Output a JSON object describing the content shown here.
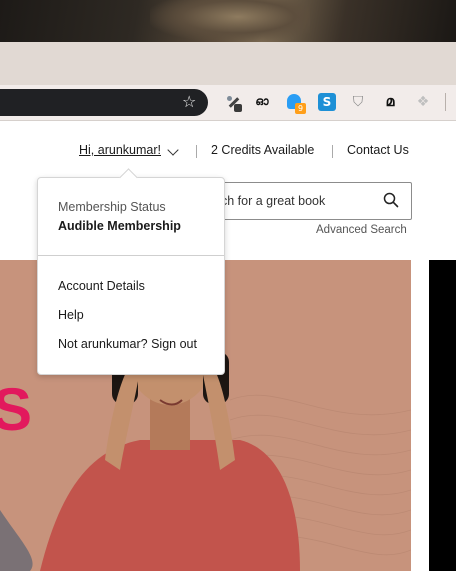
{
  "browser": {
    "extensions": [
      "eyedropper-icon",
      "glasses-icon",
      "ghost-icon",
      "s-extension-icon",
      "pocket-icon",
      "malayalam-icon",
      "grid-icon"
    ],
    "ghost_badge": "9",
    "glasses_glyph": "ഓ",
    "s_glyph": "S",
    "ml_glyph": "മ"
  },
  "header": {
    "greeting": "Hi, arunkumar!",
    "credits": "2 Credits Available",
    "contact": "Contact Us"
  },
  "search": {
    "placeholder": "ch for a great book",
    "advanced": "Advanced Search"
  },
  "account_menu": {
    "status_label": "Membership Status",
    "status_value": "Audible Membership",
    "items": [
      "Account Details",
      "Help",
      "Not arunkumar? Sign out"
    ]
  },
  "hero": {
    "partial_text": "S",
    "accent_color": "#e2195d",
    "background_color": "#c7937c"
  }
}
